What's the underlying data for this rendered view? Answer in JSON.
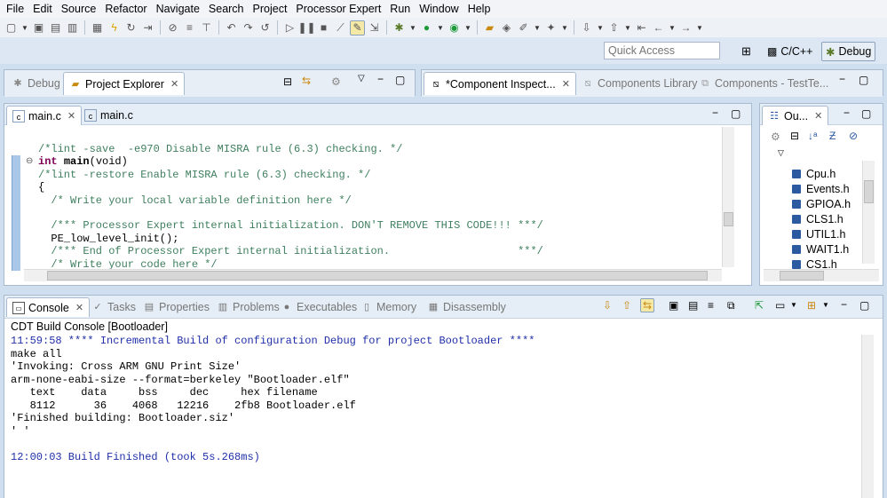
{
  "menu": [
    "File",
    "Edit",
    "Source",
    "Refactor",
    "Navigate",
    "Search",
    "Project",
    "Processor Expert",
    "Run",
    "Window",
    "Help"
  ],
  "quick_access": {
    "placeholder": "Quick Access"
  },
  "perspectives": [
    {
      "label": "C/C++",
      "icon": "cpp-perspective-icon"
    },
    {
      "label": "Debug",
      "icon": "debug-perspective-icon",
      "active": true
    }
  ],
  "left_panel": {
    "tabs": [
      {
        "label": "Debug",
        "icon": "debug-icon",
        "active": false
      },
      {
        "label": "Project Explorer",
        "icon": "folder-icon",
        "active": true
      }
    ]
  },
  "right_top_panel": {
    "tabs": [
      {
        "label": "*Component Inspect...",
        "icon": "component-inspector-icon",
        "active": true
      },
      {
        "label": "Components Library",
        "icon": "library-icon",
        "active": false
      },
      {
        "label": "Components - TestTe...",
        "icon": "components-icon",
        "active": false
      }
    ]
  },
  "editor": {
    "tabs": [
      {
        "label": "main.c",
        "icon": "c-file-icon",
        "active": true
      },
      {
        "label": "main.c",
        "icon": "c-file-icon",
        "active": false
      }
    ],
    "lines": [
      {
        "type": "comment",
        "text": "/*lint -save  -e970 Disable MISRA rule (6.3) checking. */",
        "indent": 0
      },
      {
        "type": "signature",
        "kw": "int ",
        "fn": "main",
        "rest": "(void)",
        "indent": 0
      },
      {
        "type": "comment",
        "text": "/*lint -restore Enable MISRA rule (6.3) checking. */",
        "indent": 0
      },
      {
        "type": "plain",
        "text": "{",
        "indent": 0
      },
      {
        "type": "comment",
        "text": "/* Write your local variable definition here */",
        "indent": 2
      },
      {
        "type": "plain",
        "text": "",
        "indent": 0
      },
      {
        "type": "comment",
        "text": "/*** Processor Expert internal initialization. DON'T REMOVE THIS CODE!!! ***/",
        "indent": 2
      },
      {
        "type": "plain",
        "text": "PE_low_level_init();",
        "indent": 2
      },
      {
        "type": "comment",
        "text": "/*** End of Processor Expert internal initialization.                    ***/",
        "indent": 2
      },
      {
        "type": "comment",
        "text": "/* Write your code here */",
        "indent": 2
      }
    ]
  },
  "outline": {
    "tab_label": "Ou...",
    "items": [
      "Cpu.h",
      "Events.h",
      "GPIOA.h",
      "CLS1.h",
      "UTIL1.h",
      "WAIT1.h",
      "CS1.h"
    ]
  },
  "console": {
    "tabs": [
      {
        "label": "Console",
        "icon": "console-icon",
        "active": true
      },
      {
        "label": "Tasks",
        "icon": "tasks-icon",
        "active": false
      },
      {
        "label": "Properties",
        "icon": "properties-icon",
        "active": false
      },
      {
        "label": "Problems",
        "icon": "problems-icon",
        "active": false
      },
      {
        "label": "Executables",
        "icon": "executables-icon",
        "active": false
      },
      {
        "label": "Memory",
        "icon": "memory-icon",
        "active": false
      },
      {
        "label": "Disassembly",
        "icon": "disassembly-icon",
        "active": false
      }
    ],
    "title": "CDT Build Console [Bootloader]",
    "lines": [
      {
        "color": "blue",
        "text": "11:59:58 **** Incremental Build of configuration Debug for project Bootloader ****"
      },
      {
        "color": "black",
        "text": "make all"
      },
      {
        "color": "black",
        "text": "'Invoking: Cross ARM GNU Print Size'"
      },
      {
        "color": "black",
        "text": "arm-none-eabi-size --format=berkeley \"Bootloader.elf\""
      },
      {
        "color": "black",
        "text": "   text    data     bss     dec     hex filename"
      },
      {
        "color": "black",
        "text": "   8112      36    4068   12216    2fb8 Bootloader.elf"
      },
      {
        "color": "black",
        "text": "'Finished building: Bootloader.siz'"
      },
      {
        "color": "black",
        "text": "' '"
      },
      {
        "color": "black",
        "text": ""
      },
      {
        "color": "blue",
        "text": "12:00:03 Build Finished (took 5s.268ms)"
      }
    ]
  },
  "colors": {
    "comment": "#3f7f5f",
    "keyword": "#7f0055",
    "console_blue": "#1f2fa8"
  }
}
